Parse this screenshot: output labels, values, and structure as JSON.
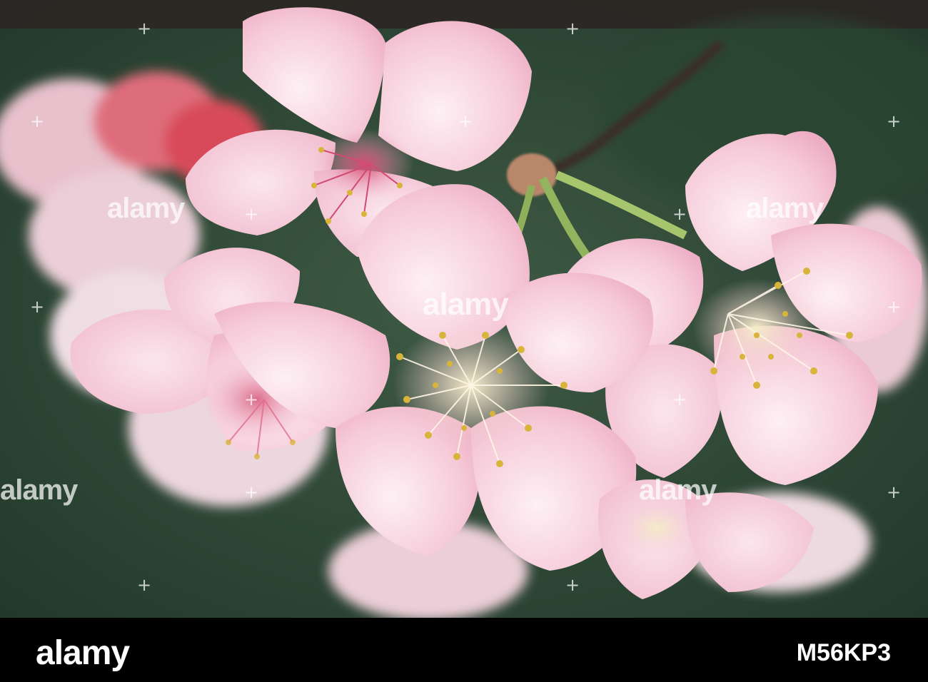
{
  "watermark": {
    "brand": "alamy",
    "plus_glyph": "+"
  },
  "footer": {
    "logo": "alamy",
    "image_id": "M56KP3"
  },
  "colors": {
    "background_green": "#2e4a36",
    "petal_pink": "#f5c6d6",
    "petal_light": "#fbe6ee",
    "stamen_yellow": "#d9b43a",
    "branch_brown": "#4a3a30"
  },
  "subject": {
    "icon": "cherry-blossom-icon"
  }
}
